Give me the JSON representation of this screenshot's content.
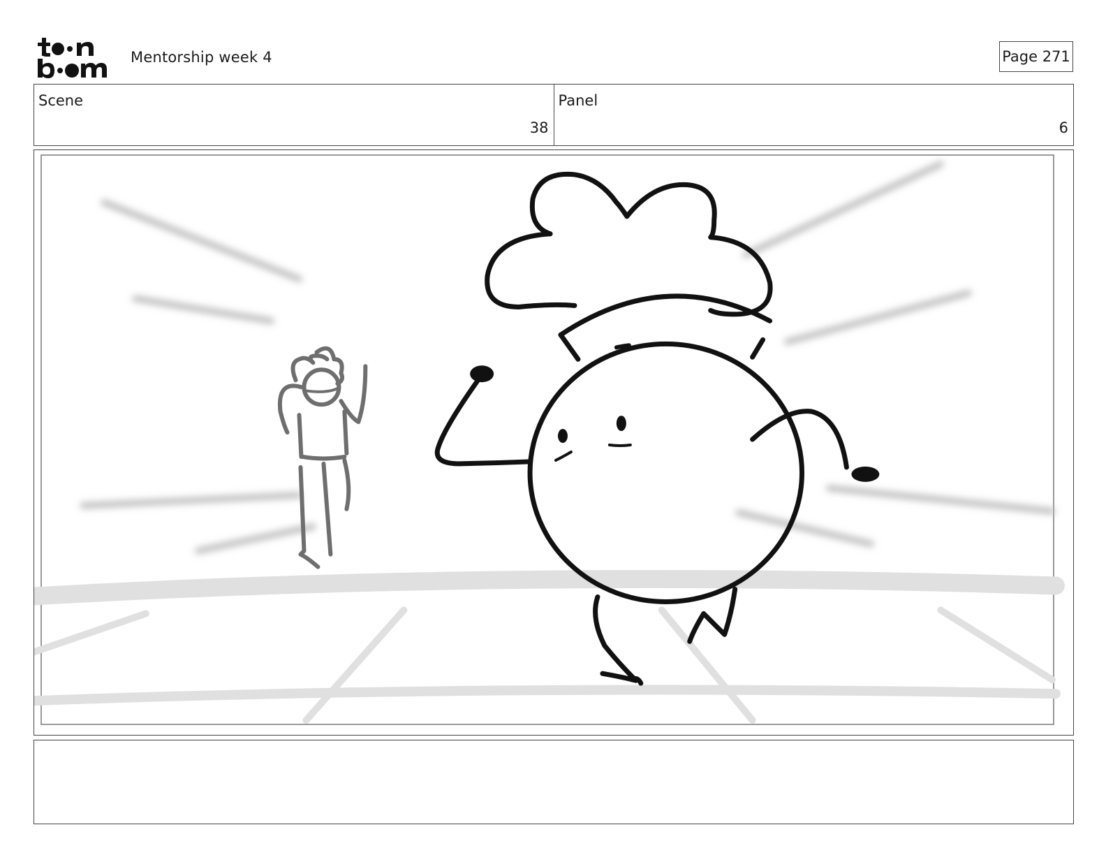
{
  "header": {
    "logo_text": "toon boom",
    "project_title": "Mentorship week 4",
    "page_label": "Page 271"
  },
  "info": {
    "scene_label": "Scene",
    "scene_value": "38",
    "panel_label": "Panel",
    "panel_value": "6"
  },
  "drawing": {
    "description_icon": "storyboard-sketch-icon"
  },
  "notes": {
    "text": ""
  }
}
